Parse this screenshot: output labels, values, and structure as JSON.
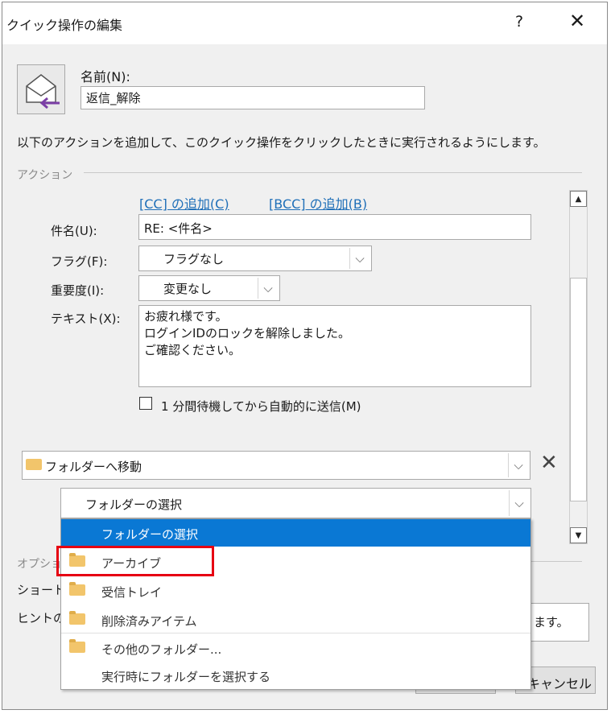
{
  "window": {
    "title": "クイック操作の編集",
    "help": "?",
    "close": "✕"
  },
  "name": {
    "label": "名前(N):",
    "value": "返信_解除"
  },
  "description": "以下のアクションを追加して、このクイック操作をクリックしたときに実行されるようにします。",
  "actions_group": "アクション",
  "reply_action": {
    "add_cc": "[CC] の追加(C)",
    "add_bcc": "[BCC] の追加(B)",
    "subject_label": "件名(U):",
    "subject_value": "RE: <件名>",
    "flag_label": "フラグ(F):",
    "flag_value": "フラグなし",
    "importance_label": "重要度(I):",
    "importance_value": "変更なし",
    "text_label": "テキスト(X):",
    "text_lines": [
      "お疲れ様です。",
      "ログインIDのロックを解除しました。",
      "ご確認ください。"
    ],
    "delay_checkbox": "1 分間待機してから自動的に送信(M)",
    "delay_checked": false
  },
  "move_action": {
    "value": "フォルダーへ移動",
    "remove": "✕",
    "folder_select_value": "フォルダーの選択"
  },
  "folder_dropdown": {
    "items": [
      {
        "label": "フォルダーの選択",
        "selected": true,
        "icon": ""
      },
      {
        "label": "アーカイブ",
        "selected": false,
        "icon": "folder-icon"
      },
      {
        "label": "受信トレイ",
        "selected": false,
        "icon": "folder-icon"
      },
      {
        "label": "削除済みアイテム",
        "selected": false,
        "icon": "folder-icon"
      },
      {
        "label": "その他のフォルダー...",
        "selected": false,
        "icon": "folder-move-icon"
      },
      {
        "label": "実行時にフォルダーを選択する",
        "selected": false,
        "icon": ""
      }
    ]
  },
  "options": {
    "group_label_partial": "オプショ",
    "shortcut_partial": "ショート:",
    "hint_partial": "ヒントの",
    "hint_text_partial": "ます。"
  },
  "buttons": {
    "cancel": "キャンセル"
  },
  "colors": {
    "selection": "#0a78d4",
    "link": "#1f6fb8",
    "highlight_box": "#e60012",
    "folder": "#f2c56b",
    "reply_arrow": "#7b3fa6"
  }
}
